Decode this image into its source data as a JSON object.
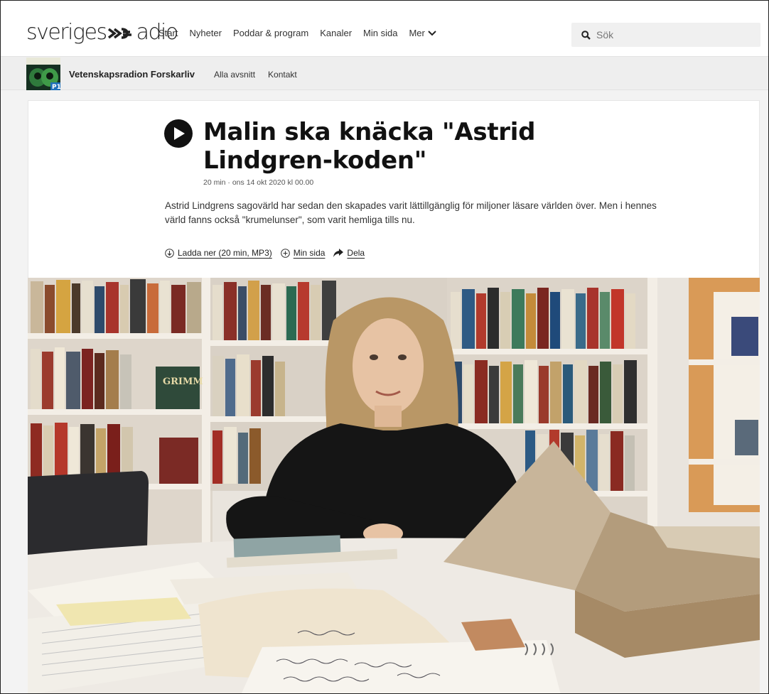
{
  "header": {
    "logo_text_left": "sveriges",
    "logo_text_right": "adio",
    "nav": [
      {
        "label": "Start"
      },
      {
        "label": "Nyheter"
      },
      {
        "label": "Poddar & program"
      },
      {
        "label": "Kanaler"
      },
      {
        "label": "Min sida"
      }
    ],
    "more_label": "Mer",
    "search_placeholder": "Sök",
    "search_icon": "search-icon"
  },
  "program": {
    "name": "Vetenskapsradion Forskarliv",
    "links": [
      "Alla avsnitt",
      "Kontakt"
    ],
    "thumb_badge": "P1"
  },
  "episode": {
    "title": "Malin ska knäcka \"Astrid Lindgren-koden\"",
    "meta": "20 min  ·  ons 14 okt 2020 kl 00.00",
    "description": "Astrid Lindgrens sagovärld har sedan den skapades varit lättillgänglig för miljoner läsare världen över. Men i hennes värld fanns också \"krumelunser\", som varit hemliga tills nu.",
    "actions": {
      "download": "Ladda ner (20 min, MP3)",
      "my_page": "Min sida",
      "share": "Dela"
    }
  },
  "photo": {
    "book_label": "GRIMM"
  },
  "colors": {
    "accent": "#111111",
    "nav_bg": "#ffffff",
    "progbar_bg": "#eeeeee",
    "search_bg": "#f0f0f0"
  }
}
